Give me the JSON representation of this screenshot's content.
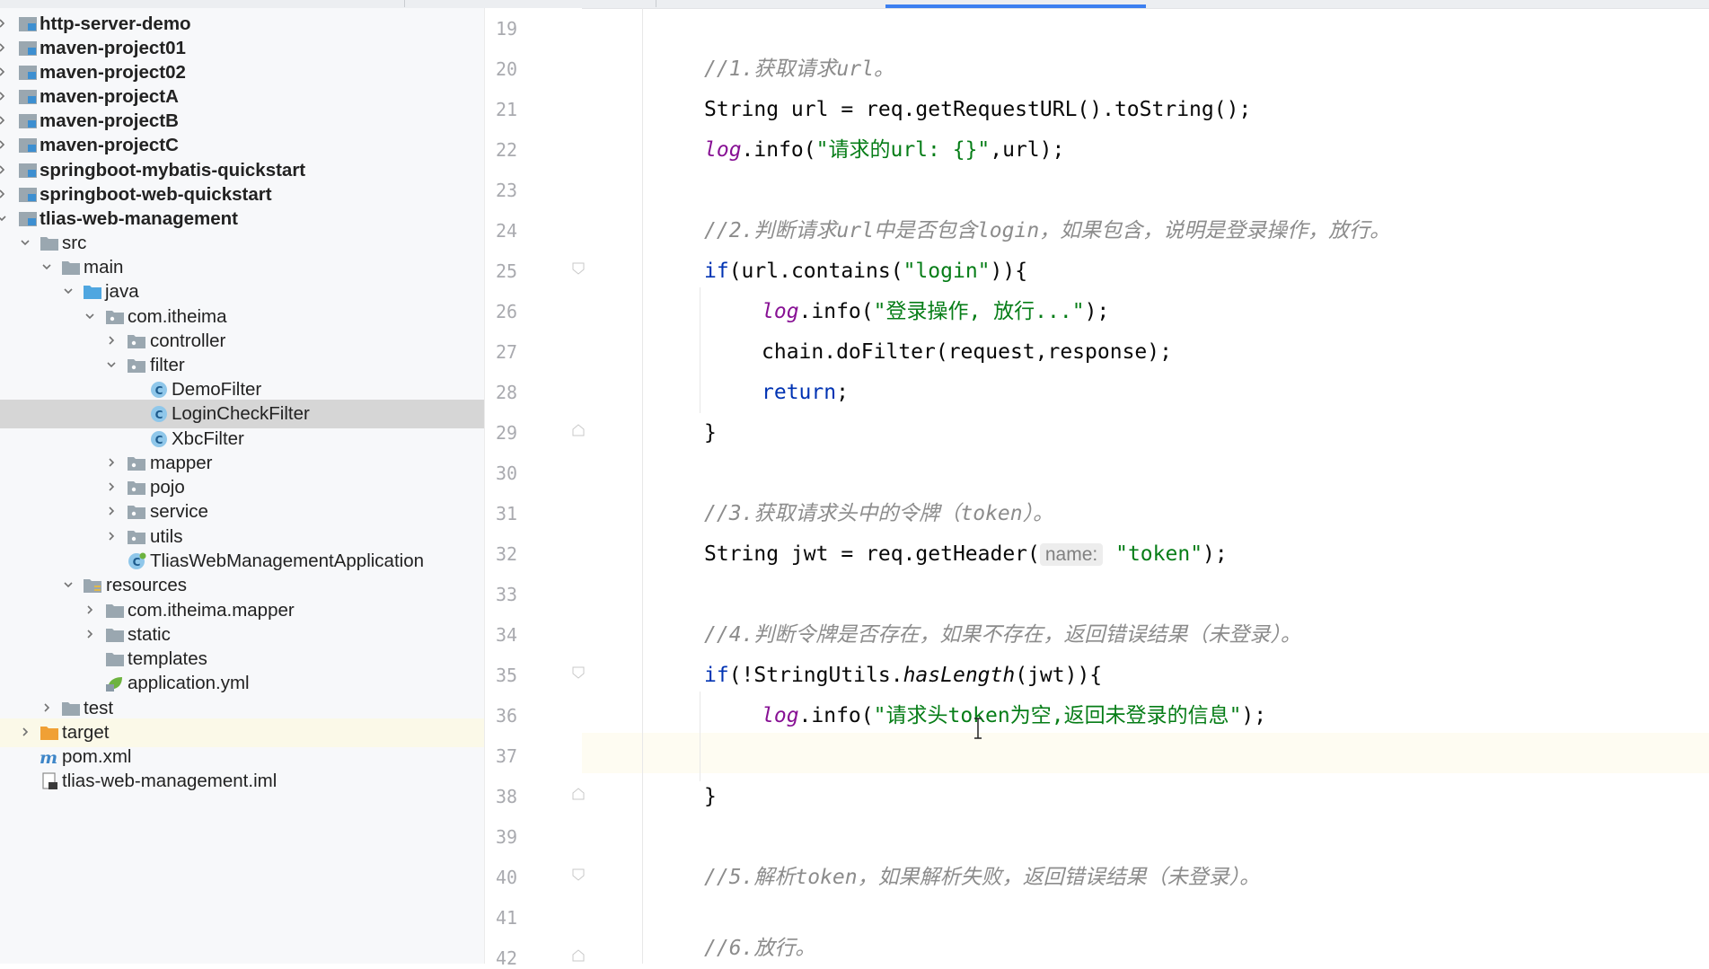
{
  "project_tree": {
    "items": [
      {
        "label": "http-server-demo",
        "icon": "module-icon",
        "bold": true
      },
      {
        "label": "maven-project01",
        "icon": "module-icon",
        "bold": true
      },
      {
        "label": "maven-project02",
        "icon": "module-icon",
        "bold": true
      },
      {
        "label": "maven-projectA",
        "icon": "module-icon",
        "bold": true
      },
      {
        "label": "maven-projectB",
        "icon": "module-icon",
        "bold": true
      },
      {
        "label": "maven-projectC",
        "icon": "module-icon",
        "bold": true
      },
      {
        "label": "springboot-mybatis-quickstart",
        "icon": "module-icon",
        "bold": true
      },
      {
        "label": "springboot-web-quickstart",
        "icon": "module-icon",
        "bold": true
      },
      {
        "label": "tlias-web-management",
        "icon": "module-icon",
        "bold": true
      },
      {
        "label": "src",
        "icon": "folder-icon"
      },
      {
        "label": "main",
        "icon": "folder-icon"
      },
      {
        "label": "java",
        "icon": "source-folder-icon"
      },
      {
        "label": "com.itheima",
        "icon": "package-icon"
      },
      {
        "label": "controller",
        "icon": "package-icon"
      },
      {
        "label": "filter",
        "icon": "package-icon"
      },
      {
        "label": "DemoFilter",
        "icon": "java-class-icon"
      },
      {
        "label": "LoginCheckFilter",
        "icon": "java-class-icon",
        "selected": true
      },
      {
        "label": "XbcFilter",
        "icon": "java-class-icon"
      },
      {
        "label": "mapper",
        "icon": "package-icon"
      },
      {
        "label": "pojo",
        "icon": "package-icon"
      },
      {
        "label": "service",
        "icon": "package-icon"
      },
      {
        "label": "utils",
        "icon": "package-icon"
      },
      {
        "label": "TliasWebManagementApplication",
        "icon": "springboot-class-icon"
      },
      {
        "label": "resources",
        "icon": "resources-folder-icon"
      },
      {
        "label": "com.itheima.mapper",
        "icon": "folder-icon"
      },
      {
        "label": "static",
        "icon": "folder-icon"
      },
      {
        "label": "templates",
        "icon": "folder-icon"
      },
      {
        "label": "application.yml",
        "icon": "spring-yml-icon"
      },
      {
        "label": "test",
        "icon": "folder-icon"
      },
      {
        "label": "target",
        "icon": "excluded-folder-icon"
      },
      {
        "label": "pom.xml",
        "icon": "maven-icon"
      },
      {
        "label": "tlias-web-management.iml",
        "icon": "iml-file-icon"
      }
    ]
  },
  "editor": {
    "line_numbers": [
      "19",
      "20",
      "21",
      "22",
      "23",
      "24",
      "25",
      "26",
      "27",
      "28",
      "29",
      "30",
      "31",
      "32",
      "33",
      "34",
      "35",
      "36",
      "37",
      "38",
      "39",
      "40",
      "41",
      "42"
    ],
    "current_line": "37",
    "code": {
      "l20_comment": "//1.获取请求url。",
      "l21_a": "String url = req.getRequestURL().toString();",
      "l22_log": "log",
      "l22_a": ".info(",
      "l22_str": "\"请求的url: {}\"",
      "l22_b": ",url);",
      "l24_comment": "//2.判断请求url中是否包含login，如果包含，说明是登录操作，放行。",
      "l25_kw": "if",
      "l25_a": "(url.contains(",
      "l25_str": "\"login\"",
      "l25_b": ")){",
      "l26_log": "log",
      "l26_a": ".info(",
      "l26_str": "\"登录操作, 放行...\"",
      "l26_b": ");",
      "l27_a": "chain.doFilter(request,response);",
      "l28_kw": "return",
      "l28_b": ";",
      "l29_a": "}",
      "l31_comment": "//3.获取请求头中的令牌（token）。",
      "l32_a": "String jwt = req.getHeader(",
      "l32_hint": "name:",
      "l32_str": "\"token\"",
      "l32_b": ");",
      "l34_comment": "//4.判断令牌是否存在，如果不存在，返回错误结果（未登录）。",
      "l35_kw": "if",
      "l35_a": "(!StringUtils.",
      "l35_static": "hasLength",
      "l35_b": "(jwt)){",
      "l36_log": "log",
      "l36_a": ".info(",
      "l36_str": "\"请求头token为空,返回未登录的信息\"",
      "l36_b": ");",
      "l38_a": "}",
      "l40_comment": "//5.解析token，如果解析失败，返回错误结果（未登录）。",
      "l42_comment": "//6.放行。"
    }
  },
  "colors": {
    "keyword": "#0033b3",
    "string": "#067d17",
    "comment": "#8c8c8c",
    "log_field": "#871094",
    "selection": "#d6d6d6",
    "tab_indicator": "#3c7ff0"
  }
}
